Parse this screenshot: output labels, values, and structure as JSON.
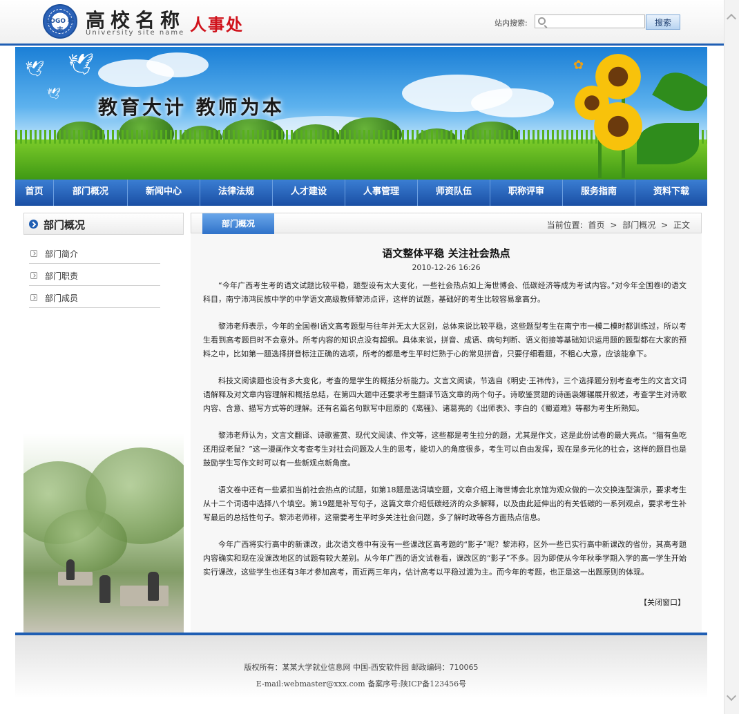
{
  "header": {
    "logo_seal_text": "LOGO 标志",
    "site_title": "高校名称",
    "site_subtitle": "University site name",
    "department": "人事处"
  },
  "search": {
    "label": "站内搜索:",
    "placeholder": "",
    "value": "",
    "button_label": "搜索"
  },
  "banner": {
    "slogan": "教育大计 教师为本"
  },
  "nav": {
    "items": [
      {
        "label": "首页"
      },
      {
        "label": "部门概况"
      },
      {
        "label": "新闻中心"
      },
      {
        "label": "法律法规"
      },
      {
        "label": "人才建设"
      },
      {
        "label": "人事管理"
      },
      {
        "label": "师资队伍"
      },
      {
        "label": "职称评审"
      },
      {
        "label": "服务指南"
      },
      {
        "label": "资料下载"
      }
    ]
  },
  "sidebar": {
    "title": "部门概况",
    "items": [
      {
        "label": "部门简介"
      },
      {
        "label": "部门职责"
      },
      {
        "label": "部门成员"
      }
    ]
  },
  "breadcrumb": {
    "tab_label": "部门概况",
    "prefix": "当前位置:",
    "items": [
      "首页",
      "部门概况",
      "正文"
    ],
    "separator": ">"
  },
  "article": {
    "title": "语文整体平稳 关注社会热点",
    "date": "2010-12-26 16:26",
    "paragraphs": [
      "“今年广西考生考的语文试题比较平稳，题型设有太大变化，一些社会热点如上海世博会、低碳经济等成为考试内容。”对今年全国卷Ⅰ的语文科目，南宁沛鸿民族中学的中学语文高级教师黎沛点评，这样的试题，基础好的考生比较容易拿高分。",
      "黎沛老师表示，今年的全国卷Ⅰ语文高考题型与往年并无太大区别，总体来说比较平稳，这些题型考生在南宁市一模二模时都训练过，所以考生看到高考题目时不会意外。所考内容的知识点没有超纲。具体来说，拼音、成语、病句判断、语义衔接等基础知识运用题的题型都在大家的预料之中，比如第一题选择拼音标注正确的选项，所考的都是考生平时烂熟于心的常见拼音，只要仔细看题，不粗心大意，应该能拿下。",
      "科技文阅读题也没有多大变化，考查的是学生的概括分析能力。文言文阅读，节选自《明史·王祎传》，三个选择题分别考查考生的文言文词语解释及对文章内容理解和概括总结，在第四大题中还要求考生翻译节选文章的两个句子。诗歌鉴赏题的诗画袅娜辗展开叙述，考查学生对诗歌内容、含意、描写方式等的理解。还有名篇名句默写中屈原的《离骚》、诸葛亮的《出师表》、李白的《蜀道难》等都为考生所熟知。",
      "黎沛老师认为，文言文翻译、诗歌鉴赏、现代文阅读、作文等，这些都是考生拉分的题，尤其是作文，这是此份试卷的最大亮点。“猫有鱼吃还用捉老鼠？”这一漫画作文考查考生对社会问题及人生的思考，能切入的角度很多，考生可以自由发挥，现在是多元化的社会，这样的题目也是鼓励学生写作文时可以有一些新观点新角度。",
      "语文卷中还有一些紧扣当前社会热点的试题，如第18题是选词填空题，文章介绍上海世博会北京馆为观众做的一次交换连型演示，要求考生从十二个词语中选择八个填空。第19题是补写句子，这篇文章介绍低碳经济的众多解释，以及由此延伸出的有关低碳的一系列观点，要求考生补写最后的总括性句子。黎沛老师称，这需要考生平时多关注社会问题，多了解时政等各方面热点信息。",
      "今年广西将实行高中的新课改，此次语文卷中有没有一些课改区高考题的“影子”呢？黎沛称，区外一些已实行高中新课改的省份，其高考题内容确实和现在没课改地区的试题有较大差别。从今年广西的语文试卷看，课改区的“影子”不多。因为即使从今年秋季学期入学的高一学生开始实行课改，这些学生也还有3年才参加高考，而近两三年内，估计高考以平稳过渡为主。而今年的考题，也正是这一出题原则的体现。"
    ],
    "close_label": "【关闭窗口】"
  },
  "footer": {
    "copyright": "版权所有：某某大学就业信息网 中国-西安软件园  邮政编码：710065",
    "contact": "E-mail:webmaster@xxx.com 备案序号:陕ICP备123456号"
  },
  "colors": {
    "brand_blue": "#1f5eb3",
    "nav_top": "#3b7ed3",
    "nav_bottom": "#1a4fa4",
    "dept_red": "#d0121b"
  }
}
